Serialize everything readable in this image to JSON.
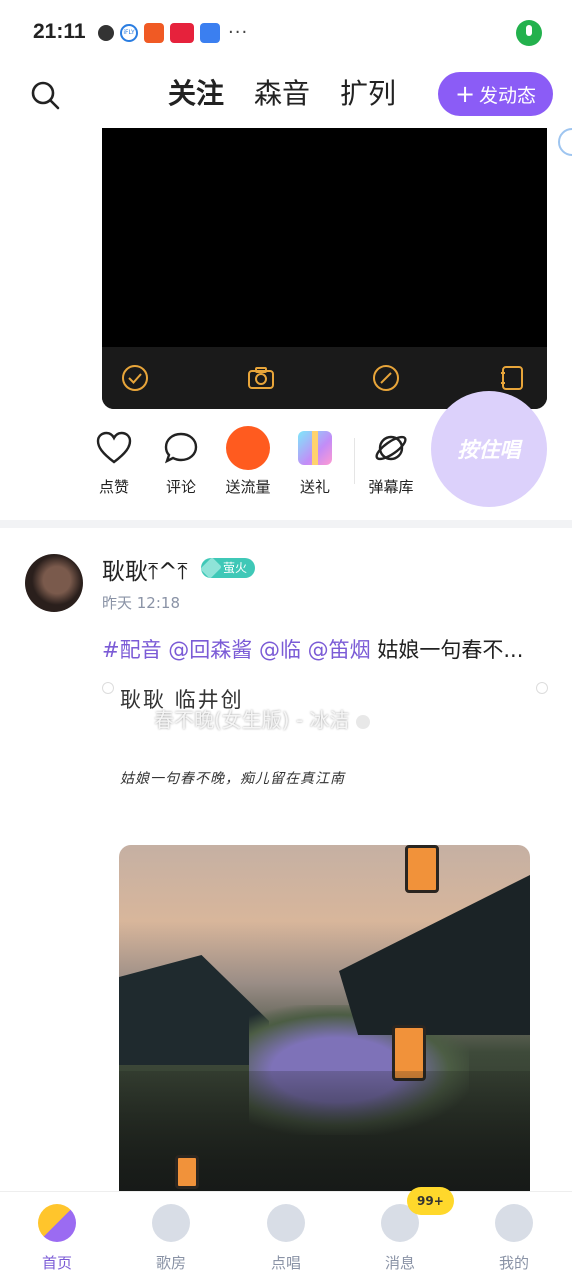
{
  "status_bar": {
    "time": "21:11",
    "more": "···"
  },
  "header": {
    "tabs": [
      {
        "label": "关注",
        "active": true
      },
      {
        "label": "森音",
        "active": false
      },
      {
        "label": "扩列",
        "active": false
      }
    ],
    "post_button": {
      "label": "发动态"
    }
  },
  "actions": {
    "like": "点赞",
    "comment": "评论",
    "send_flow": "送流量",
    "gift": "送礼",
    "danmaku": "弹幕库",
    "hold_sing": "按住唱"
  },
  "post": {
    "username": "耿耿⤒^⤒",
    "badge": "萤火",
    "time": "昨天 12:18",
    "text_tags": [
      "#配音",
      "@回森酱",
      "@临",
      "@笛烟"
    ],
    "text_body": "姑娘一句春不...",
    "lyric_card": {
      "handwritten_name": "耿耿   临井创",
      "song": "春不晚(女生版) - 冰洁",
      "line": "姑娘一句春不晚，痴儿留在真江南"
    }
  },
  "bottom_nav": {
    "items": [
      {
        "label": "首页",
        "active": true
      },
      {
        "label": "歌房",
        "active": false
      },
      {
        "label": "点唱",
        "active": false
      },
      {
        "label": "消息",
        "active": false
      },
      {
        "label": "我的",
        "active": false
      }
    ],
    "message_badge": "99+"
  },
  "colors": {
    "accent": "#8b5cf6",
    "tab_underline": "#ffdd2b",
    "flow": "#ff5b1f",
    "badge": "#3fc8b7"
  }
}
